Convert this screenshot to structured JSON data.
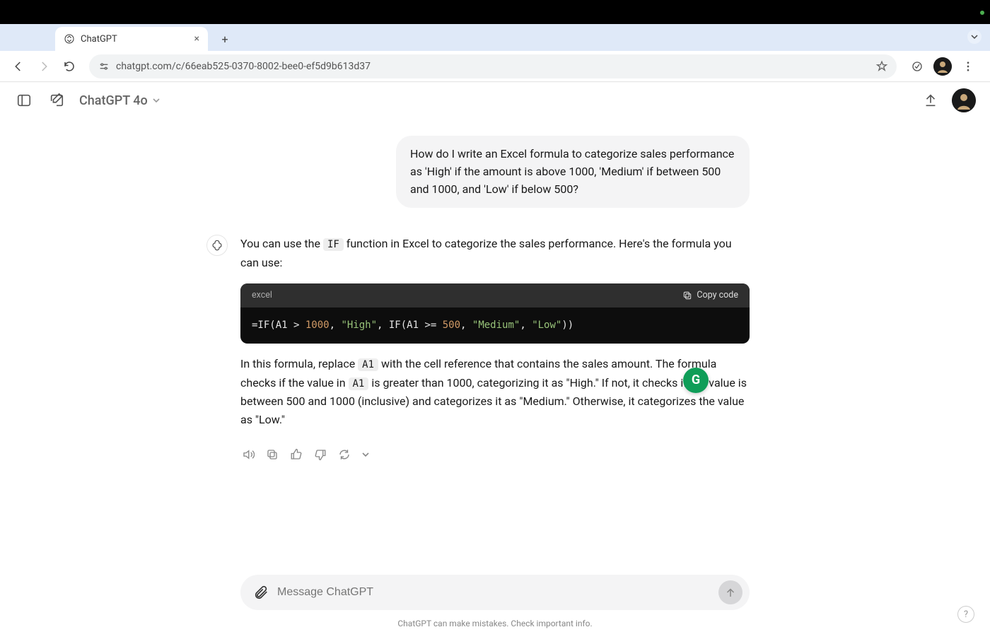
{
  "browser": {
    "tab_title": "ChatGPT",
    "url": "chatgpt.com/c/66eab525-0370-8002-bee0-ef5d9b613d37"
  },
  "app_header": {
    "model_name": "ChatGPT 4o"
  },
  "conversation": {
    "user_message": "How do I write an Excel formula to categorize sales performance as 'High' if the amount is above 1000, 'Medium' if between 500 and 1000, and 'Low' if below 500?",
    "assistant_intro_pre": "You can use the ",
    "assistant_intro_code": "IF",
    "assistant_intro_post": " function in Excel to categorize the sales performance. Here's the formula you can use:",
    "code_block": {
      "language": "excel",
      "copy_label": "Copy code",
      "code_display": "=IF(A1 > 1000, \"High\", IF(A1 >= 500, \"Medium\", \"Low\"))"
    },
    "assistant_explain_p1_a": "In this formula, replace ",
    "assistant_explain_code1": "A1",
    "assistant_explain_p1_b": " with the cell reference that contains the sales amount. The formula checks if the value in ",
    "assistant_explain_code2": "A1",
    "assistant_explain_p1_c": " is greater than 1000, categorizing it as \"High.\" If not, it checks if the value is between 500 and 1000 (inclusive) and categorizes it as \"Medium.\" Otherwise, it categorizes the value as \"Low.\""
  },
  "composer": {
    "placeholder": "Message ChatGPT"
  },
  "footer": {
    "note": "ChatGPT can make mistakes. Check important info."
  },
  "help": {
    "label": "?"
  },
  "grammarly": {
    "label": "G"
  }
}
